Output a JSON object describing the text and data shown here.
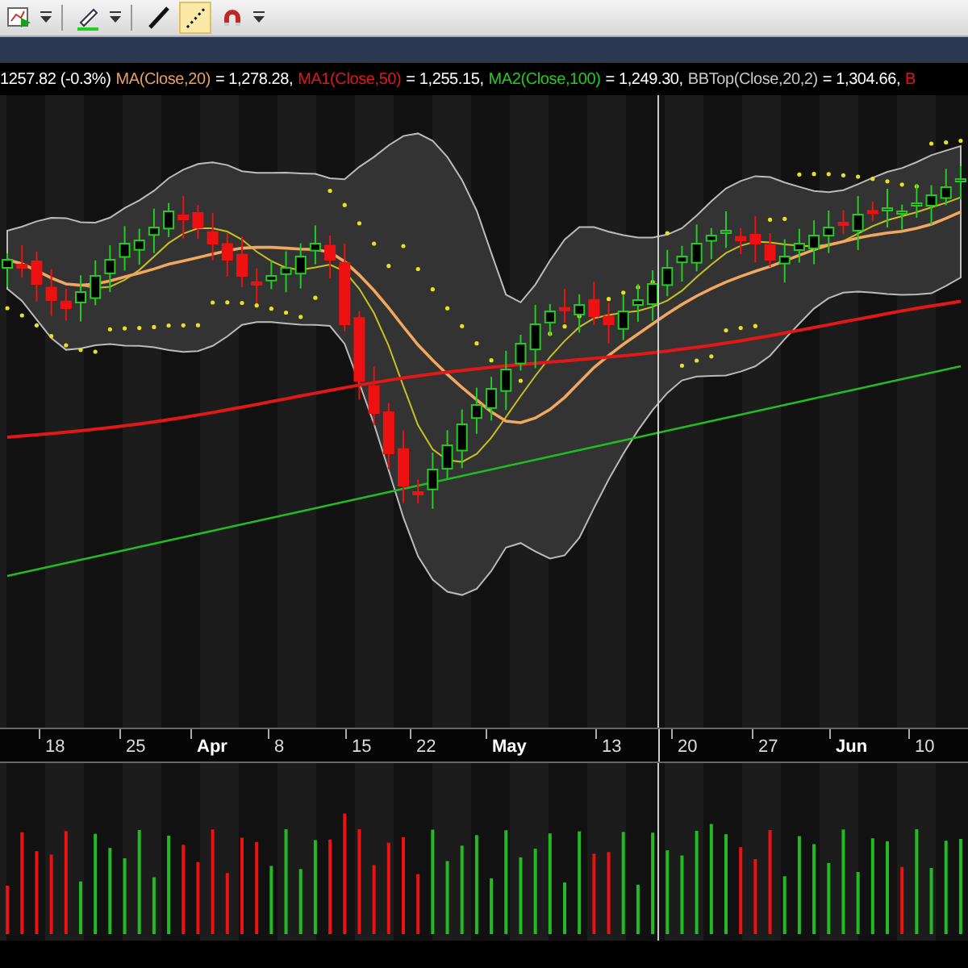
{
  "toolbar": {
    "tools": [
      {
        "kind": "chart",
        "selected": false
      },
      {
        "kind": "pen",
        "selected": false
      },
      {
        "kind": "line",
        "selected": false
      },
      {
        "kind": "dotted",
        "selected": true
      },
      {
        "kind": "magnet",
        "selected": false
      }
    ]
  },
  "legend": [
    {
      "text": "1257.82 (-0.3%)",
      "color": "#ffffff"
    },
    {
      "text": "MA(Close,20)",
      "color": "#e8a060"
    },
    {
      "text": "= 1,278.28,",
      "color": "#ffffff"
    },
    {
      "text": "MA1(Close,50)",
      "color": "#e01818"
    },
    {
      "text": "= 1,255.15,",
      "color": "#ffffff"
    },
    {
      "text": "MA2(Close,100)",
      "color": "#22cc22"
    },
    {
      "text": "= 1,249.30,",
      "color": "#ffffff"
    },
    {
      "text": "BBTop(Close,20,2)",
      "color": "#c8c8c8"
    },
    {
      "text": "= 1,304.66,",
      "color": "#ffffff"
    },
    {
      "text": "B",
      "color": "#e01818"
    }
  ],
  "x_axis": {
    "labels": [
      {
        "text": "18",
        "kind": "day"
      },
      {
        "text": "25",
        "kind": "day"
      },
      {
        "text": "Apr",
        "kind": "month"
      },
      {
        "text": "8",
        "kind": "day"
      },
      {
        "text": "15",
        "kind": "day"
      },
      {
        "text": "22",
        "kind": "day"
      },
      {
        "text": "May",
        "kind": "month"
      },
      {
        "text": "13",
        "kind": "day"
      },
      {
        "text": "20",
        "kind": "day"
      },
      {
        "text": "27",
        "kind": "day"
      },
      {
        "text": "Jun",
        "kind": "month"
      },
      {
        "text": "10",
        "kind": "day"
      }
    ]
  }
}
